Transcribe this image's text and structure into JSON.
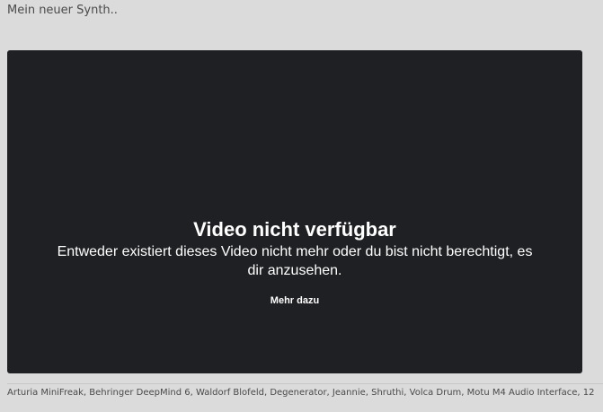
{
  "post": {
    "text": "Mein neuer Synth.."
  },
  "video": {
    "title": "Video nicht verfügbar",
    "message": "Entweder existiert dieses Video nicht mehr oder du bist nicht berechtigt, es dir anzusehen.",
    "more_link": "Mehr dazu"
  },
  "signature": {
    "text": "Arturia MiniFreak, Behringer DeepMind 6, Waldorf Blofeld, Degenerator, Jeannie, Shruthi, Volca Drum, Motu M4 Audio Interface, 12"
  }
}
